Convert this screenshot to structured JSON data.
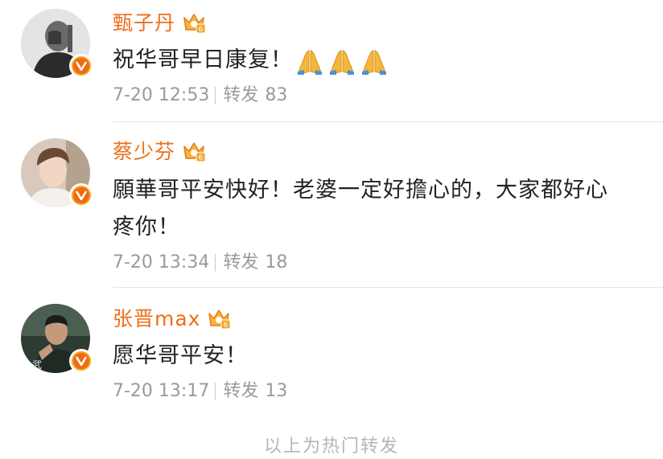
{
  "comments": [
    {
      "user": "甄子丹",
      "text": "祝华哥早日康复！",
      "emojis": [
        "folded-hands",
        "folded-hands",
        "folded-hands"
      ],
      "date": "7-20 12:53",
      "repost_label": "转发",
      "repost_count": "83"
    },
    {
      "user": "蔡少芬",
      "text_line1": "願華哥平安快好！老婆一定好擔心的，大家都好心",
      "text_line2": "疼你！",
      "date": "7-20 13:34",
      "repost_label": "转发",
      "repost_count": "18"
    },
    {
      "user": "张晋max",
      "text": "愿华哥平安！",
      "date": "7-20 13:17",
      "repost_label": "转发",
      "repost_count": "13"
    }
  ],
  "footer": "以上为热门转发",
  "colors": {
    "username": "#ef6f1a",
    "verified_badge": "#f5a623",
    "meta_text": "#9a9a9a",
    "comment_text": "#222222"
  },
  "icons": {
    "verified": "verified-v-icon",
    "member": "vip-crown-icon",
    "emoji": "folded-hands-emoji"
  }
}
